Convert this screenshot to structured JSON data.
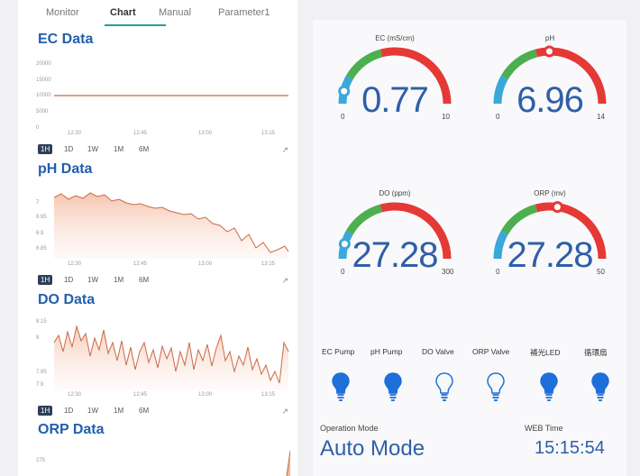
{
  "tabs": [
    "Monitor",
    "Chart",
    "Manual",
    "Parameter1"
  ],
  "charts": {
    "ec": {
      "title": "EC Data",
      "yticks": [
        "20000",
        "15000",
        "10000",
        "5000",
        "0"
      ],
      "xticks": [
        "12:30",
        "12:45",
        "13:00",
        "13:15"
      ],
      "line_color": "#c86b45"
    },
    "ph": {
      "title": "pH Data",
      "yticks": [
        "7",
        "6.95",
        "6.9",
        "6.85"
      ],
      "xticks": [
        "12:30",
        "12:45",
        "13:00",
        "13:15"
      ]
    },
    "do": {
      "title": "DO Data",
      "yticks": [
        "8.15",
        "8",
        "7.95",
        "7.9"
      ],
      "xticks": [
        "12:30",
        "12:45",
        "13:00",
        "13:15"
      ]
    },
    "orp": {
      "title": "ORP Data",
      "yticks": [
        "275"
      ]
    }
  },
  "ranges": [
    "1H",
    "1D",
    "1W",
    "1M",
    "6M"
  ],
  "gauges": [
    {
      "title": "EC (mS/cm)",
      "value": "0.77",
      "min": "0",
      "max": "10",
      "fraction": 0.077
    },
    {
      "title": "pH",
      "value": "6.96",
      "min": "0",
      "max": "14",
      "fraction": 0.497
    },
    {
      "title": "DO (ppm)",
      "value": "27.28",
      "min": "0",
      "max": "300",
      "fraction": 0.091
    },
    {
      "title": "ORP (mv)",
      "value": "27.28",
      "min": "0",
      "max": "50",
      "fraction": 0.546
    }
  ],
  "devices": [
    {
      "label": "EC Pump",
      "on": true
    },
    {
      "label": "pH Pump",
      "on": true
    },
    {
      "label": "DO Valve",
      "on": false
    },
    {
      "label": "ORP Valve",
      "on": false
    },
    {
      "label": "補光LED",
      "on": true
    },
    {
      "label": "循環扇",
      "on": true
    }
  ],
  "operation": {
    "label": "Operation Mode",
    "value": "Auto  Mode"
  },
  "web_time": {
    "label": "WEB Time",
    "value": "15:15:54"
  },
  "colors": {
    "accent": "#2f5fa8",
    "gauge_blue": "#3aa8d8",
    "gauge_green": "#4caf50",
    "gauge_red": "#e53935",
    "bulb_blue": "#1e6fd9"
  }
}
